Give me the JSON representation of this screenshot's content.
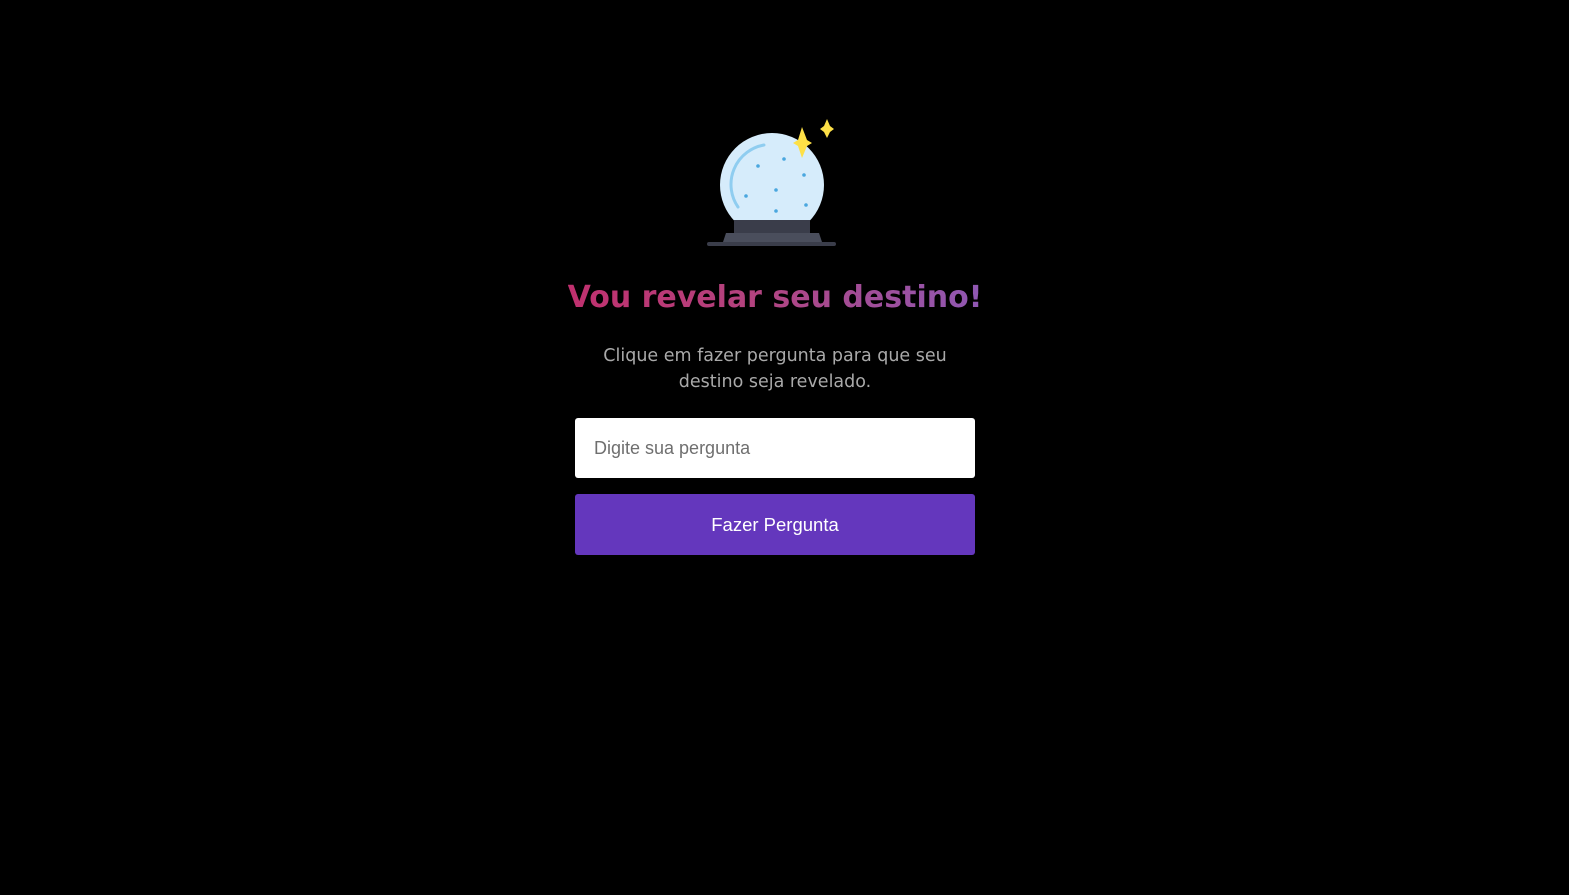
{
  "hero": {
    "icon": "crystal-ball-icon",
    "title": "Vou revelar seu destino!",
    "description": "Clique em fazer pergunta para que seu destino seja revelado."
  },
  "form": {
    "question_placeholder": "Digite sua pergunta",
    "question_value": "",
    "submit_label": "Fazer Pergunta"
  },
  "colors": {
    "background": "#000000",
    "title_gradient_start": "#c0306e",
    "title_gradient_end": "#8f58b3",
    "description_text": "#a9a9a9",
    "button_bg": "#6437bd",
    "button_text": "#ffffff",
    "orb_glass": "#d6ecfb",
    "sparkle": "#fde047"
  }
}
